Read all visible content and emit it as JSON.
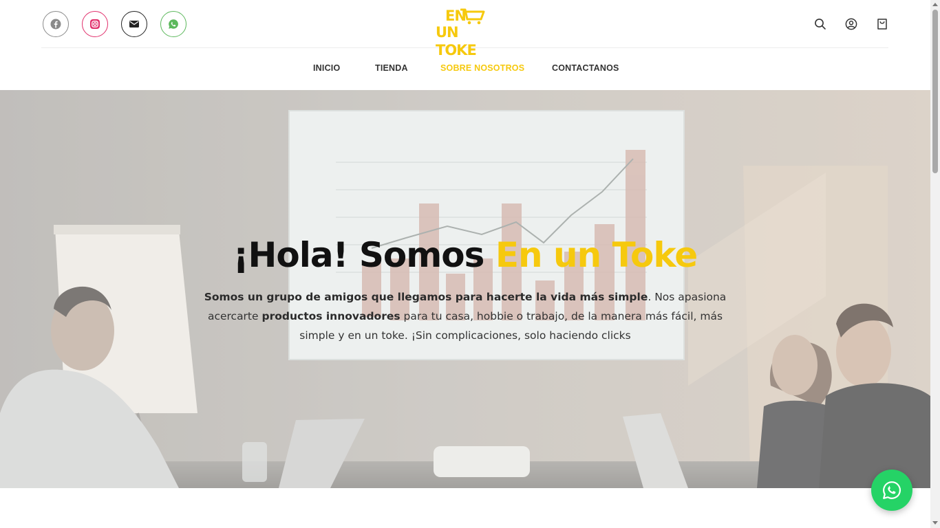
{
  "brand": {
    "logo_line1": "EN",
    "logo_line2": "UN TOKE",
    "color": "#f6c90e"
  },
  "social": [
    {
      "name": "facebook",
      "icon": "facebook-icon",
      "color": "#8a8a8a"
    },
    {
      "name": "instagram",
      "icon": "instagram-icon",
      "color": "#e1306c"
    },
    {
      "name": "email",
      "icon": "mail-icon",
      "color": "#222222"
    },
    {
      "name": "whatsapp",
      "icon": "whatsapp-icon",
      "color": "#5cb85c"
    }
  ],
  "header_icons": [
    "search-icon",
    "user-icon",
    "cart-icon"
  ],
  "nav": {
    "items": [
      {
        "label": "INICIO",
        "active": false
      },
      {
        "label": "TIENDA",
        "active": false
      },
      {
        "label": "SOBRE NOSOTROS",
        "active": true
      },
      {
        "label": "CONTACTANOS",
        "active": false
      }
    ],
    "active_color": "#f6c90e",
    "text_color": "#333333"
  },
  "hero": {
    "title_part1": "¡Hola! Somos ",
    "title_highlight": "En un Toke",
    "text": {
      "bold1": "Somos un grupo de amigos que llegamos para hacerte la vida más simple",
      "normal1": ". Nos apasiona acercarte ",
      "bold2": "productos innovadores",
      "normal2": " para tu casa, hobbie o trabajo, de la manera más fácil, más simple y  en un toke. ¡Sin complicaciones, solo haciendo clicks"
    }
  },
  "floating_button": {
    "icon": "whatsapp-icon",
    "color": "#25d366"
  }
}
